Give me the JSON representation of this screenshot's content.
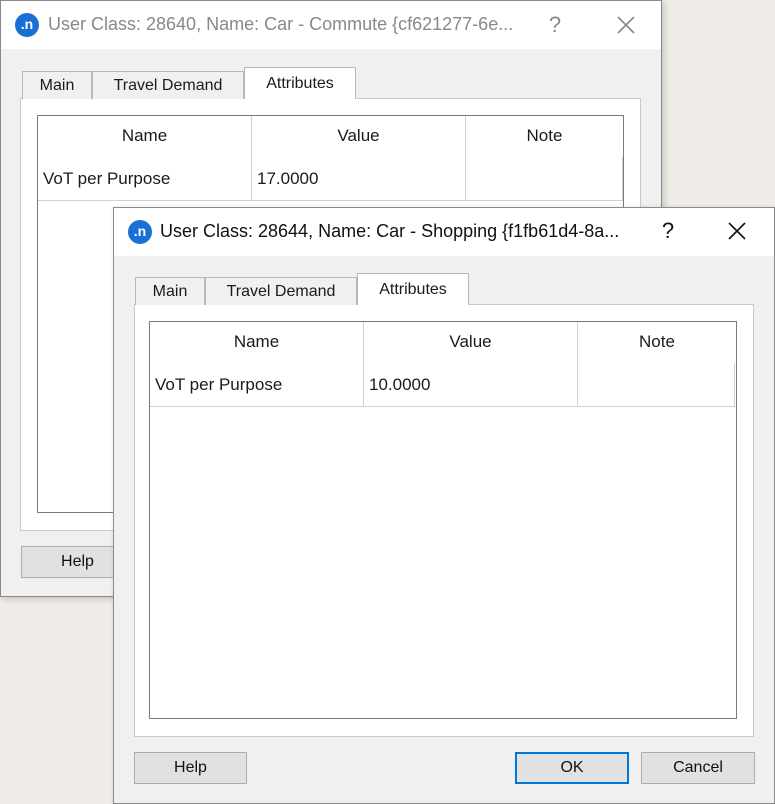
{
  "back_dialog": {
    "title": "User Class: 28640, Name: Car - Commute  {cf621277-6e...",
    "help_label": "?",
    "tabs": [
      {
        "label": "Main"
      },
      {
        "label": "Travel Demand"
      },
      {
        "label": "Attributes",
        "selected": true
      }
    ],
    "table": {
      "headers": [
        "Name",
        "Value",
        "Note"
      ],
      "rows": [
        [
          "VoT per Purpose",
          "17.0000",
          ""
        ]
      ]
    },
    "buttons": {
      "help": "Help"
    }
  },
  "front_dialog": {
    "title": "User Class: 28644, Name: Car - Shopping  {f1fb61d4-8a...",
    "help_label": "?",
    "tabs": [
      {
        "label": "Main"
      },
      {
        "label": "Travel Demand"
      },
      {
        "label": "Attributes",
        "selected": true
      }
    ],
    "table": {
      "headers": [
        "Name",
        "Value",
        "Note"
      ],
      "rows": [
        [
          "VoT per Purpose",
          "10.0000",
          ""
        ]
      ]
    },
    "buttons": {
      "help": "Help",
      "ok": "OK",
      "cancel": "Cancel"
    }
  },
  "icons": {
    "app": "app-n-icon",
    "close": "close-icon",
    "help": "help-question-icon"
  },
  "colors": {
    "accent": "#0078d7",
    "app_icon": "#1a6fd4"
  }
}
